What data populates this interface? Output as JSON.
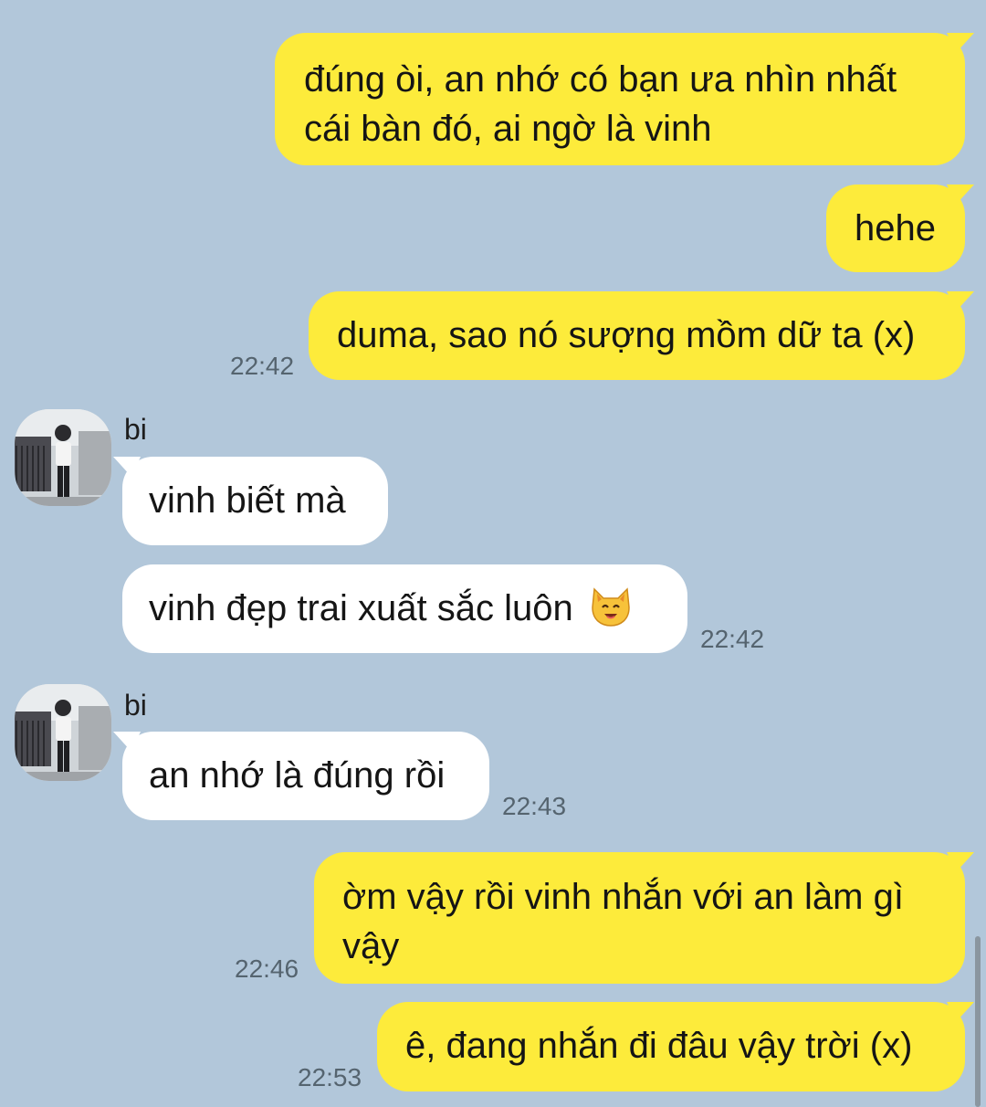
{
  "messages": [
    {
      "id": "m1",
      "side": "mine",
      "text_lines": [
        "đúng òi, an nhớ có bạn ưa nhìn nhất",
        "cái bàn đó, ai ngờ là vinh"
      ],
      "time": ""
    },
    {
      "id": "m2",
      "side": "mine",
      "text": "hehe",
      "time": ""
    },
    {
      "id": "m3",
      "side": "mine",
      "text": "duma, sao nó sượng mồm dữ ta (x)",
      "time": "22:42"
    },
    {
      "id": "m4",
      "side": "theirs",
      "sender": "bi",
      "text": "vinh biết mà",
      "time": ""
    },
    {
      "id": "m5",
      "side": "theirs",
      "text": "vinh đẹp trai xuất sắc luôn",
      "emoji": "cat-face-icon",
      "time": "22:42"
    },
    {
      "id": "m6",
      "side": "theirs",
      "sender": "bi",
      "text": "an nhớ là đúng rồi",
      "time": "22:43"
    },
    {
      "id": "m7",
      "side": "mine",
      "text_lines": [
        "ờm vậy rồi vinh nhắn với an làm gì",
        "vậy"
      ],
      "time": "22:46"
    },
    {
      "id": "m8",
      "side": "mine",
      "text": "ê, đang nhắn đi đâu vậy trời (x)",
      "time": "22:53"
    }
  ],
  "colors": {
    "background": "#b2c7da",
    "mine_bubble": "#fdeb3b",
    "theirs_bubble": "#ffffff",
    "timestamp": "#55646f"
  }
}
